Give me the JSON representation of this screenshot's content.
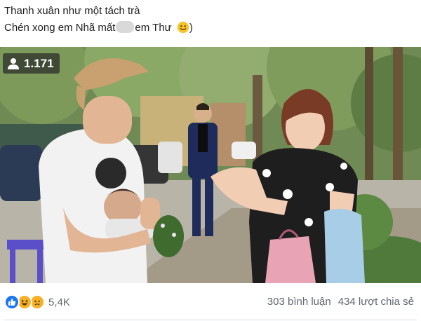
{
  "caption": {
    "line1": "Thanh xuân như một tách trà",
    "line2_before": "Chén xong em Nhã mất",
    "line2_after": "em Thư",
    "line2_end": ")"
  },
  "video": {
    "view_count": "1.171"
  },
  "reactions": {
    "types": [
      "like",
      "haha",
      "sad"
    ],
    "count": "5,4K"
  },
  "stats": {
    "comments": "303 bình luận",
    "shares": "434 lượt chia sẻ"
  },
  "colors": {
    "like_blue": "#1877f2",
    "reaction_yellow": "#f7b125",
    "text": "#1c1e21",
    "meta_text": "#606770"
  }
}
